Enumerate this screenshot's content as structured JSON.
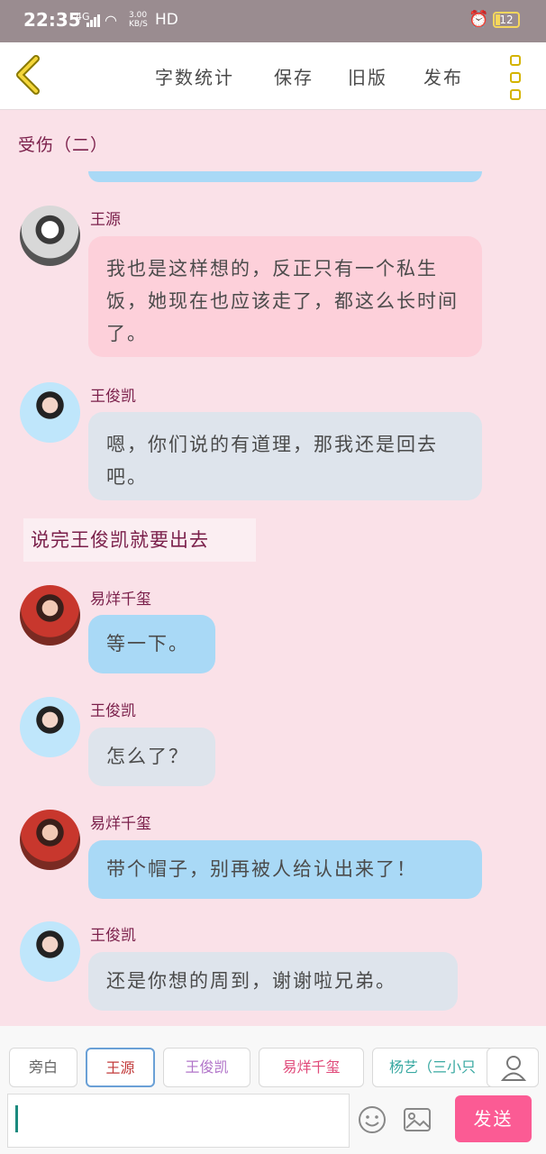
{
  "status_bar": {
    "time": "22:35",
    "signal": "4G",
    "speed": "3.00\nKB/S",
    "hd": "HD",
    "battery": "12"
  },
  "toolbar": {
    "word_count_label": "字数统计",
    "save_label": "保存",
    "old_version_label": "旧版",
    "publish_label": "发布"
  },
  "chapter": {
    "title": "受伤（二）"
  },
  "messages": [
    {
      "name": "王源",
      "text": "我也是这样想的，反正只有一个私生饭，她现在也应该走了，都这么长时间了。"
    },
    {
      "name": "王俊凯",
      "text": "嗯，你们说的有道理，那我还是回去吧。"
    },
    {
      "name": "易烊千玺",
      "text": "等一下。"
    },
    {
      "name": "王俊凯",
      "text": "怎么了？"
    },
    {
      "name": "易烊千玺",
      "text": "带个帽子，别再被人给认出来了！"
    },
    {
      "name": "王俊凯",
      "text": "还是你想的周到，谢谢啦兄弟。"
    }
  ],
  "narration": "说完王俊凯就要出去",
  "characters": [
    "旁白",
    "王源",
    "王俊凯",
    "易烊千玺",
    "杨艺（三小只"
  ],
  "composer": {
    "placeholder": "",
    "send_label": "发送"
  },
  "colors": {
    "background": "#fae1e8",
    "pink_bubble": "#fdd0da",
    "grey_bubble": "#dee4ec",
    "blue_bubble": "#a9d9f6",
    "send_button": "#fb5b94",
    "accent_yellow": "#d4b300"
  }
}
